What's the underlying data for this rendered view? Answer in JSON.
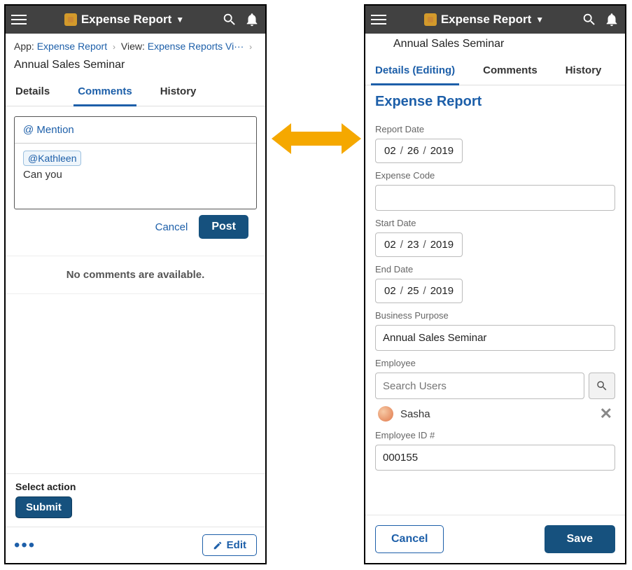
{
  "header": {
    "title": "Expense Report"
  },
  "left": {
    "breadcrumb": {
      "app_label": "App:",
      "app_link": "Expense Report",
      "view_label": "View:",
      "view_link": "Expense Reports Vi···"
    },
    "page_title": "Annual Sales Seminar",
    "tabs": {
      "details": "Details",
      "comments": "Comments",
      "history": "History"
    },
    "compose": {
      "mention_label": "@ Mention",
      "chip": "@Kathleen",
      "body_text": "Can you",
      "cancel": "Cancel",
      "post": "Post"
    },
    "no_comments": "No comments are available.",
    "select_action_label": "Select action",
    "submit": "Submit",
    "edit": "Edit"
  },
  "right": {
    "page_title": "Annual Sales Seminar",
    "tabs": {
      "details_editing": "Details (Editing)",
      "comments": "Comments",
      "history": "History"
    },
    "form_title": "Expense Report",
    "fields": {
      "report_date": {
        "label": "Report Date",
        "mm": "02",
        "dd": "26",
        "yyyy": "2019"
      },
      "expense_code": {
        "label": "Expense Code",
        "value": ""
      },
      "start_date": {
        "label": "Start Date",
        "mm": "02",
        "dd": "23",
        "yyyy": "2019"
      },
      "end_date": {
        "label": "End Date",
        "mm": "02",
        "dd": "25",
        "yyyy": "2019"
      },
      "business_purpose": {
        "label": "Business Purpose",
        "value": "Annual Sales Seminar"
      },
      "employee": {
        "label": "Employee",
        "placeholder": "Search Users",
        "selected": "Sasha"
      },
      "employee_id": {
        "label": "Employee ID #",
        "value": "000155"
      }
    },
    "cancel": "Cancel",
    "save": "Save"
  }
}
